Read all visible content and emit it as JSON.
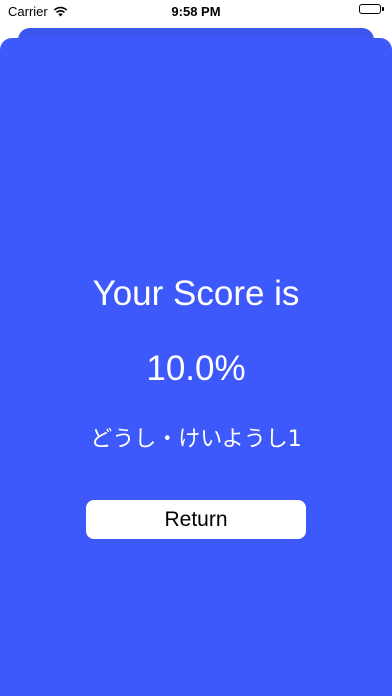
{
  "status_bar": {
    "carrier": "Carrier",
    "time": "9:58 PM",
    "icons": [
      "wifi-icon",
      "battery-icon"
    ]
  },
  "result": {
    "title": "Your Score is",
    "score": "10.0%",
    "quiz_name": "どうし・けいようし1"
  },
  "actions": {
    "return_label": "Return"
  },
  "colors": {
    "background": "#3d59fb",
    "button_background": "#ffffff",
    "text": "#ffffff"
  }
}
